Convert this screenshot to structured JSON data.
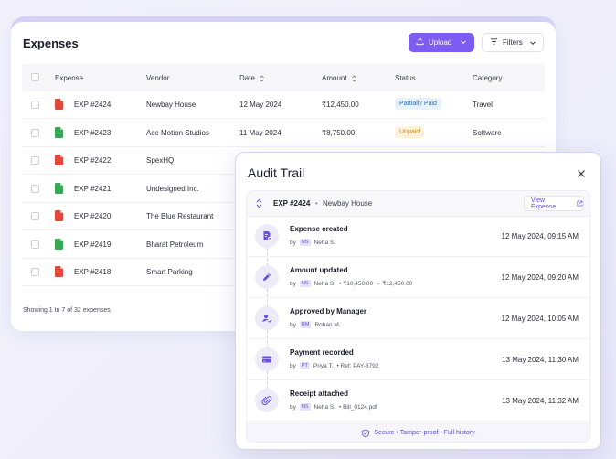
{
  "colors": {
    "accent": "#7c5cf2",
    "pdf": "#e5483b",
    "sheet": "#34a853",
    "partial_bg": "#e7f2fb",
    "partial_fg": "#2e72b8",
    "unpaid_bg": "#fdf3de",
    "unpaid_fg": "#c9861b"
  },
  "expenses": {
    "title": "Expenses",
    "upload_label": "Upload",
    "filters_label": "Filters",
    "columns": [
      "Expense",
      "Vendor",
      "Date",
      "Amount",
      "Status",
      "Category"
    ],
    "rows": [
      {
        "file": "pdf",
        "id": "EXP #2424",
        "vendor": "Newbay House",
        "date": "12 May 2024",
        "amount": "₹12,450.00",
        "status": "Partially Paid",
        "category": "Travel"
      },
      {
        "file": "sheet",
        "id": "EXP #2423",
        "vendor": "Ace Motion Studios",
        "date": "11 May 2024",
        "amount": "₹8,750.00",
        "status": "Unpaid",
        "category": "Software"
      },
      {
        "file": "pdf",
        "id": "EXP #2422",
        "vendor": "SpexHQ"
      },
      {
        "file": "sheet",
        "id": "EXP #2421",
        "vendor": "Undesigned Inc."
      },
      {
        "file": "pdf",
        "id": "EXP #2420",
        "vendor": "The Blue Restaurant"
      },
      {
        "file": "sheet",
        "id": "EXP #2419",
        "vendor": "Bharat Petroleum"
      },
      {
        "file": "pdf",
        "id": "EXP #2418",
        "vendor": "Smart Parking"
      }
    ],
    "footer": "Showing 1 to 7 of 32 expenses"
  },
  "audit": {
    "title": "Audit Trail",
    "expense_id": "EXP #2424",
    "separator": "•",
    "vendor": "Newbay House",
    "view_label": "View Expense",
    "events": [
      {
        "icon": "receipt-add-icon",
        "title": "Expense created",
        "by": "by",
        "initials": "NS",
        "user": "Neha S.",
        "extra": "",
        "time": "12 May 2024, 09:15 AM"
      },
      {
        "icon": "pencil-icon",
        "title": "Amount updated",
        "by": "by",
        "initials": "NS",
        "user": "Neha S.",
        "extra": "• ₹10,450.00 → ₹12,450.00",
        "time": "12 May 2024, 09:20 AM"
      },
      {
        "icon": "user-check-icon",
        "title": "Approved by Manager",
        "by": "by",
        "initials": "RM",
        "user": "Rohan M.",
        "extra": "",
        "time": "12 May 2024, 10:05 AM"
      },
      {
        "icon": "card-icon",
        "title": "Payment recorded",
        "by": "by",
        "initials": "PT",
        "user": "Priya T.",
        "extra": "• Ref: PAY-8792",
        "time": "13 May 2024, 11:30 AM"
      },
      {
        "icon": "paperclip-icon",
        "title": "Receipt attached",
        "by": "by",
        "initials": "NS",
        "user": "Neha S.",
        "extra": "• Bill_0124.pdf",
        "time": "13 May 2024, 11:32 AM"
      }
    ],
    "footer": "Secure • Tamper-proof • Full history"
  }
}
